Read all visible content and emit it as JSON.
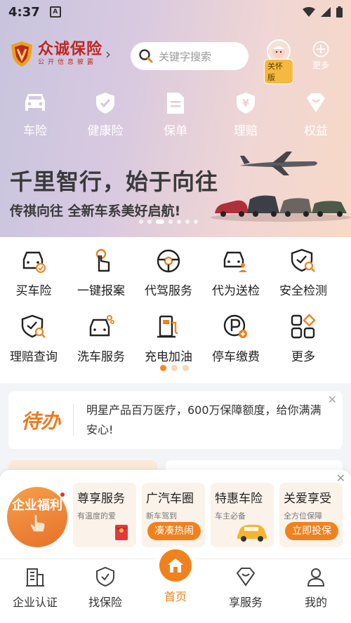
{
  "status_bar": {
    "time": "4:37",
    "a_icon": "A"
  },
  "header": {
    "logo_name": "众诚保险",
    "logo_sub": "公开信息披露",
    "search_placeholder": "关键字搜索",
    "care_label": "关怀版",
    "more_label": "更多"
  },
  "quicknav": [
    {
      "label": "车险",
      "icon": "car-icon"
    },
    {
      "label": "健康险",
      "icon": "shield-check-icon"
    },
    {
      "label": "保单",
      "icon": "document-icon"
    },
    {
      "label": "理赔",
      "icon": "yen-shield-icon"
    },
    {
      "label": "权益",
      "icon": "heart-badge-icon"
    }
  ],
  "banner": {
    "title": "千里智行，始于向往",
    "subtitle": "传祺向往 全新车系美好启航!",
    "slide_count": 7,
    "active_slide": 2
  },
  "services": {
    "row1": [
      {
        "label": "买车险",
        "icon": "car-insurance-icon"
      },
      {
        "label": "一键报案",
        "icon": "one-click-report-icon"
      },
      {
        "label": "代驾服务",
        "icon": "steering-wheel-icon"
      },
      {
        "label": "代为送检",
        "icon": "car-inspection-icon"
      },
      {
        "label": "安全检测",
        "icon": "safety-check-icon"
      }
    ],
    "row2": [
      {
        "label": "理赔查询",
        "icon": "claim-search-icon"
      },
      {
        "label": "洗车服务",
        "icon": "car-wash-icon"
      },
      {
        "label": "充电加油",
        "icon": "fuel-charge-icon"
      },
      {
        "label": "停车缴费",
        "icon": "parking-icon"
      },
      {
        "label": "更多",
        "icon": "grid-more-icon"
      }
    ],
    "page_count": 3,
    "active_page": 0
  },
  "todo": {
    "label": "待办",
    "text": "明星产品百万医疗，600万保障额度，给你满满安心!"
  },
  "welfare": {
    "label": "企业福利",
    "cards": [
      {
        "title": "尊享服务",
        "subtitle": "有温度的爱",
        "button": ""
      },
      {
        "title": "广汽车圈",
        "subtitle": "新车驾到",
        "button": "凑凑热闹"
      },
      {
        "title": "特惠车险",
        "subtitle": "车主必备",
        "button": ""
      },
      {
        "title": "关爱享受",
        "subtitle": "全方位保障",
        "button": "立即投保"
      }
    ]
  },
  "bottom_nav": [
    {
      "label": "企业认证",
      "icon": "building-icon",
      "active": false
    },
    {
      "label": "找保险",
      "icon": "shield-check-icon",
      "active": false
    },
    {
      "label": "首页",
      "icon": "home-icon",
      "active": true
    },
    {
      "label": "享服务",
      "icon": "heart-diamond-icon",
      "active": false
    },
    {
      "label": "我的",
      "icon": "user-icon",
      "active": false
    }
  ],
  "colors": {
    "accent": "#f0821e",
    "brand_red": "#c0261f",
    "care_badge": "#f5b940"
  }
}
